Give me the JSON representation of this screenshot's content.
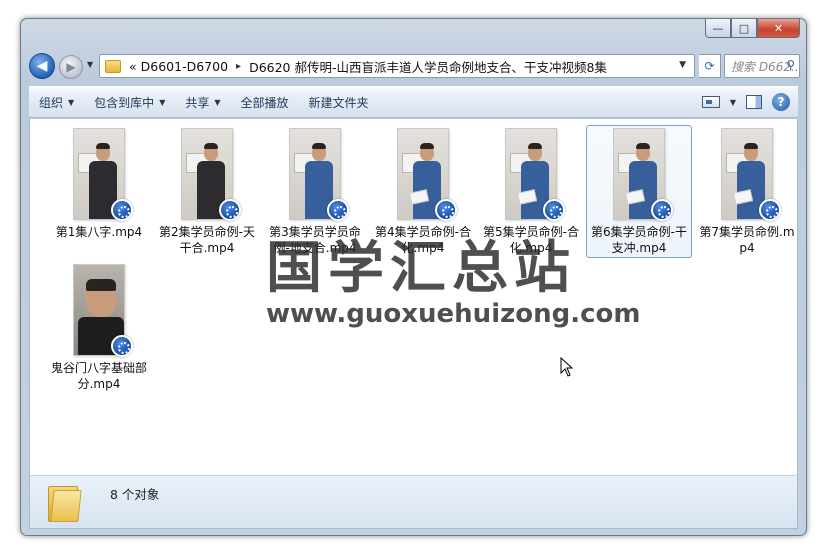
{
  "window": {
    "caption_buttons": {
      "minimize": "—",
      "maximize": "□",
      "close": "✕"
    }
  },
  "nav": {
    "back_icon": "back-arrow-icon",
    "forward_icon": "forward-arrow-icon",
    "address": {
      "overflow": "«",
      "crumbs": [
        "D6601-D6700",
        "D6620 郝传明-山西盲派丰道人学员命例地支合、干支冲视频8集"
      ],
      "separator": "▸"
    },
    "search_placeholder": "搜索 D662..."
  },
  "toolbar": {
    "organize": "组织",
    "include_in_library": "包含到库中",
    "share": "共享",
    "play_all": "全部播放",
    "new_folder": "新建文件夹"
  },
  "files": [
    {
      "name": "第1集八字.mp4",
      "outfit": "dark"
    },
    {
      "name": "第2集学员命例-天干合.mp4",
      "outfit": "dark"
    },
    {
      "name": "第3集学员学员命例-地支合.mp4",
      "outfit": "blue"
    },
    {
      "name": "第4集学员命例-合化.mp4",
      "outfit": "blue"
    },
    {
      "name": "第5集学员命例-合化.mp4",
      "outfit": "blue"
    },
    {
      "name": "第6集学员命例-干支冲.mp4",
      "outfit": "blue",
      "selected": true
    },
    {
      "name": "第7集学员命例.mp4",
      "outfit": "blue"
    },
    {
      "name": "鬼谷门八字基础部分.mp4",
      "outfit": "close-up"
    }
  ],
  "watermark": {
    "title": "国学汇总站",
    "url": "www.guoxuehuizong.com"
  },
  "status": {
    "count_text": "8 个对象"
  }
}
